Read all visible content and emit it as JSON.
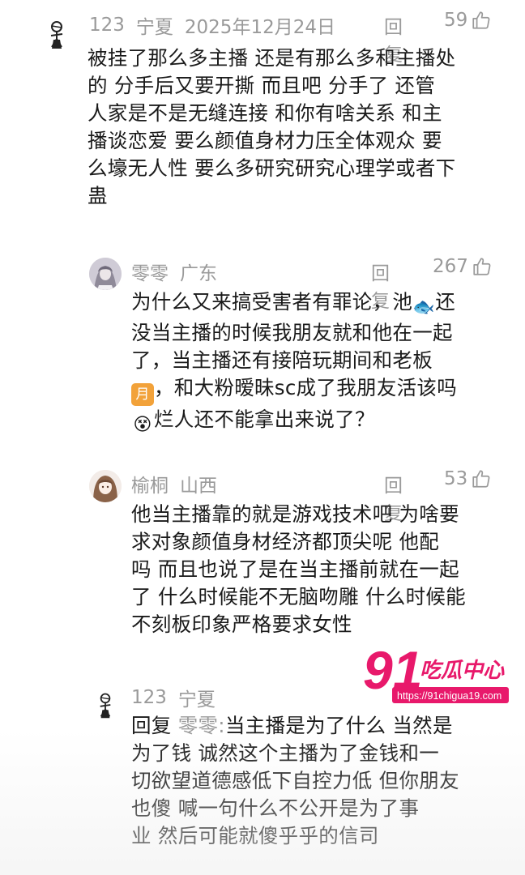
{
  "comments": [
    {
      "user": "123",
      "location": "宁夏",
      "date": "2025年12月24日",
      "reply_label": "回复",
      "likes": "59",
      "lines": [
        "被挂了那么多主播  还是有那么多和主播处",
        "的  分手后又要开撕  而且吧  分手了  还管",
        "人家是不是无缝连接  和你有啥关系   和主",
        "播谈恋爱  要么颜值身材力压全体观众  要",
        "么壕无人性  要么多研究研究心理学或者下",
        "蛊"
      ]
    },
    {
      "user": "零零",
      "location": "广东",
      "reply_label": "回复",
      "likes": "267",
      "lines": [
        "为什么又来搞受害者有罪论，池",
        "还",
        "没当主播的时候我朋友就和他在一起",
        "了，当主播还有接陪玩期间和老板",
        "，和大粉暧昧sc成了我朋友活该吗",
        "烂人还不能拿出来说了？"
      ],
      "emoji_fish": "🐟",
      "emoji_moon": "月",
      "emoji_face": "😵"
    },
    {
      "user": "榆桐",
      "location": "山西",
      "reply_label": "回复",
      "likes": "53",
      "lines": [
        "他当主播靠的就是游戏技术吧  为啥要",
        "求对象颜值身材经济都顶尖呢  他配",
        "吗  而且也说了是在当主播前就在一起",
        "了  什么时候能不无脑吻雕  什么时候能",
        "不刻板印象严格要求女性"
      ]
    },
    {
      "user": "123",
      "location": "宁夏",
      "reply_prefix": "回复",
      "reply_target": "零零:",
      "lines": [
        "当主播是为了什么  当然是",
        "为了钱   诚然这个主播为了金钱和一",
        "切欲望道德感低下自控力低  但你朋友",
        "也傻  喊一句什么不公开是为了事",
        "业   然后可能就傻乎乎的信司"
      ]
    }
  ],
  "watermark": {
    "number": "91",
    "title": "吃瓜中心",
    "url": "https://91chigua19.com"
  },
  "colors": {
    "meta_gray": "#9a9a9a",
    "text": "#1a1a1a",
    "watermark_pink": "#e8196b"
  }
}
